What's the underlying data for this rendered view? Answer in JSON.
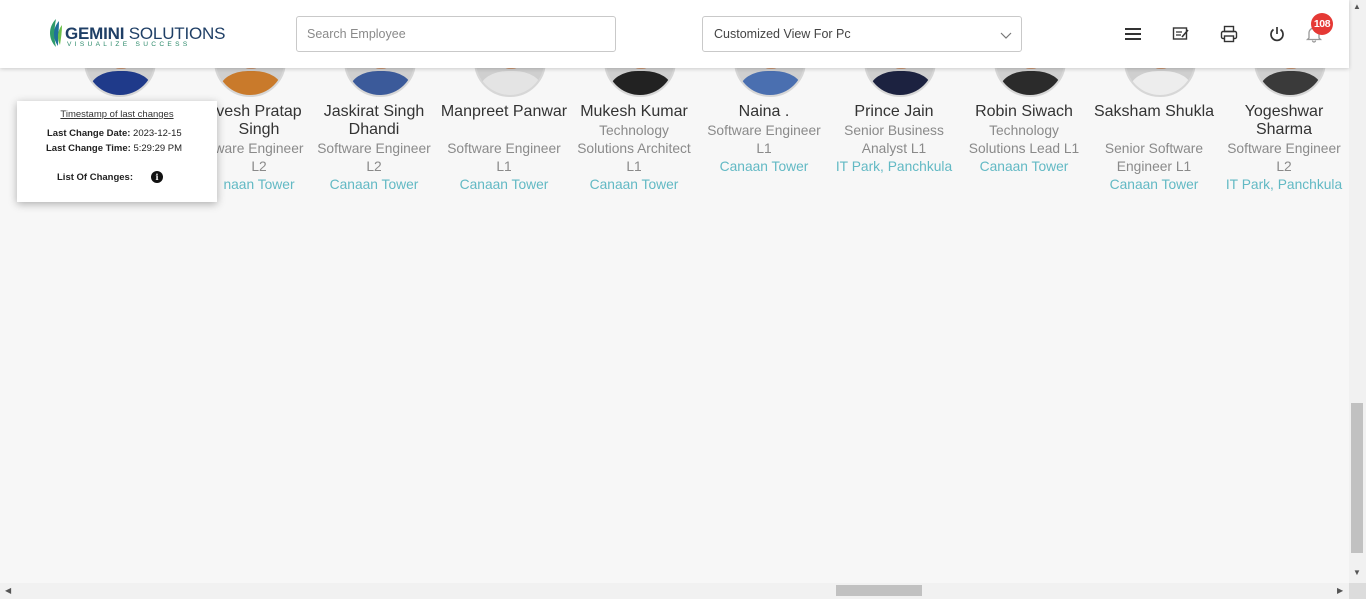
{
  "header": {
    "logo": {
      "brand_bold": "GEMINI",
      "brand_light": " SOLUTIONS",
      "tagline": "VISUALIZE SUCCESS"
    },
    "search": {
      "placeholder": "Search Employee"
    },
    "view_select": {
      "value": "Customized View For Pc"
    },
    "icons": [
      "menu-icon",
      "edit-note-icon",
      "print-icon",
      "power-icon",
      "bell-icon"
    ],
    "notification_count": "108"
  },
  "popup": {
    "title": "Timestamp of last changes",
    "last_change_date_label": "Last Change Date:",
    "last_change_date_value": "2023-12-15",
    "last_change_time_label": "Last Change Time:",
    "last_change_time_value": "5:29:29 PM",
    "list_of_changes_label": "List Of Changes:",
    "info_glyph": "i"
  },
  "employees": [
    {
      "name": "",
      "role": "",
      "location": ""
    },
    {
      "name": "vesh Pratap Singh",
      "role": "ware Engineer L2",
      "location": "naan Tower"
    },
    {
      "name": "Jaskirat Singh Dhandi",
      "role": "Software Engineer L2",
      "location": "Canaan Tower"
    },
    {
      "name": "Manpreet Panwar",
      "role": "Software Engineer L1",
      "location": "Canaan Tower"
    },
    {
      "name": "Mukesh Kumar",
      "role": "Technology Solutions Architect L1",
      "location": "Canaan Tower"
    },
    {
      "name": "Naina .",
      "role": "Software Engineer L1",
      "location": "Canaan Tower"
    },
    {
      "name": "Prince Jain",
      "role": "Senior Business Analyst L1",
      "location": "IT Park, Panchkula"
    },
    {
      "name": "Robin Siwach",
      "role": "Technology Solutions Lead L1",
      "location": "Canaan Tower"
    },
    {
      "name": "Saksham Shukla",
      "role": "Senior Software Engineer L1",
      "location": "Canaan Tower"
    },
    {
      "name": "Yogeshwar Sharma",
      "role": "Software Engineer L2",
      "location": "IT Park, Panchkula"
    }
  ],
  "colors": {
    "location_accent": "#62b9c4",
    "badge": "#e53935",
    "brand_navy": "#1f3f66"
  }
}
